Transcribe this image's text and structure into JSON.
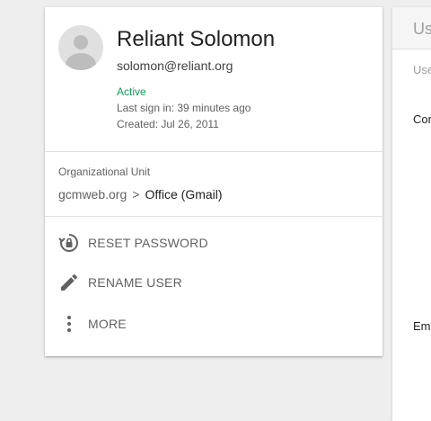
{
  "user": {
    "name": "Reliant Solomon",
    "email": "solomon@reliant.org",
    "status": "Active",
    "last_sign_in": "Last sign in: 39 minutes ago",
    "created": "Created: Jul 26, 2011"
  },
  "org_unit": {
    "label": "Organizational Unit",
    "parent": "gcmweb.org",
    "separator": ">",
    "current": "Office (Gmail)"
  },
  "actions": [
    {
      "label": "RESET PASSWORD",
      "icon": "lock-reset-icon"
    },
    {
      "label": "RENAME USER",
      "icon": "pencil-icon"
    },
    {
      "label": "MORE",
      "icon": "more-vert-icon"
    }
  ],
  "side_panel": {
    "title": "Us",
    "subtitle": "Use",
    "section1": "Cor",
    "section2": "Em"
  },
  "colors": {
    "active": "#0f9d58",
    "background": "#eeeeee",
    "card": "#ffffff"
  }
}
